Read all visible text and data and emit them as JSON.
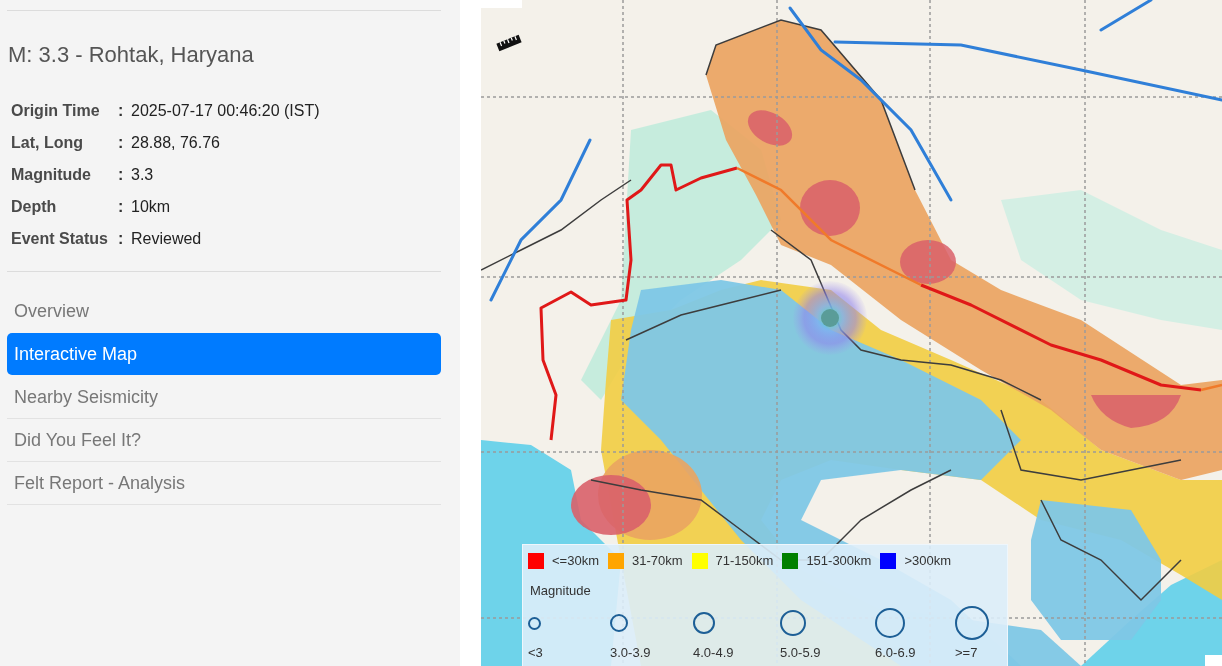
{
  "sidebar": {
    "event_title": "M: 3.3 - Rohtak, Haryana",
    "details": [
      {
        "label": "Origin Time",
        "separator": ":",
        "value": "2025-07-17 00:46:20 (IST)"
      },
      {
        "label": "Lat, Long",
        "separator": ":",
        "value": "28.88, 76.76"
      },
      {
        "label": "Magnitude",
        "separator": ":",
        "value": "3.3"
      },
      {
        "label": "Depth",
        "separator": ":",
        "value": "10km"
      },
      {
        "label": "Event Status",
        "separator": ":",
        "value": "Reviewed"
      }
    ],
    "nav": [
      {
        "label": "Overview",
        "selected": false
      },
      {
        "label": "Interactive Map",
        "selected": true
      },
      {
        "label": "Nearby Seismicity",
        "selected": false
      },
      {
        "label": "Did You Feel It?",
        "selected": false
      },
      {
        "label": "Felt Report - Analysis",
        "selected": false
      }
    ]
  },
  "map": {
    "legend": {
      "depth_classes": [
        {
          "label": "<=30km",
          "color": "#ff0000"
        },
        {
          "label": "31-70km",
          "color": "#ffa500"
        },
        {
          "label": "71-150km",
          "color": "#ffff00"
        },
        {
          "label": "151-300km",
          "color": "#008000"
        },
        {
          "label": ">300km",
          "color": "#0000ff"
        }
      ],
      "magnitude_title": "Magnitude",
      "magnitude_classes": [
        "<3",
        "3.0-3.9",
        "4.0-4.9",
        "5.0-5.9",
        "6.0-6.9",
        ">=7"
      ]
    }
  }
}
